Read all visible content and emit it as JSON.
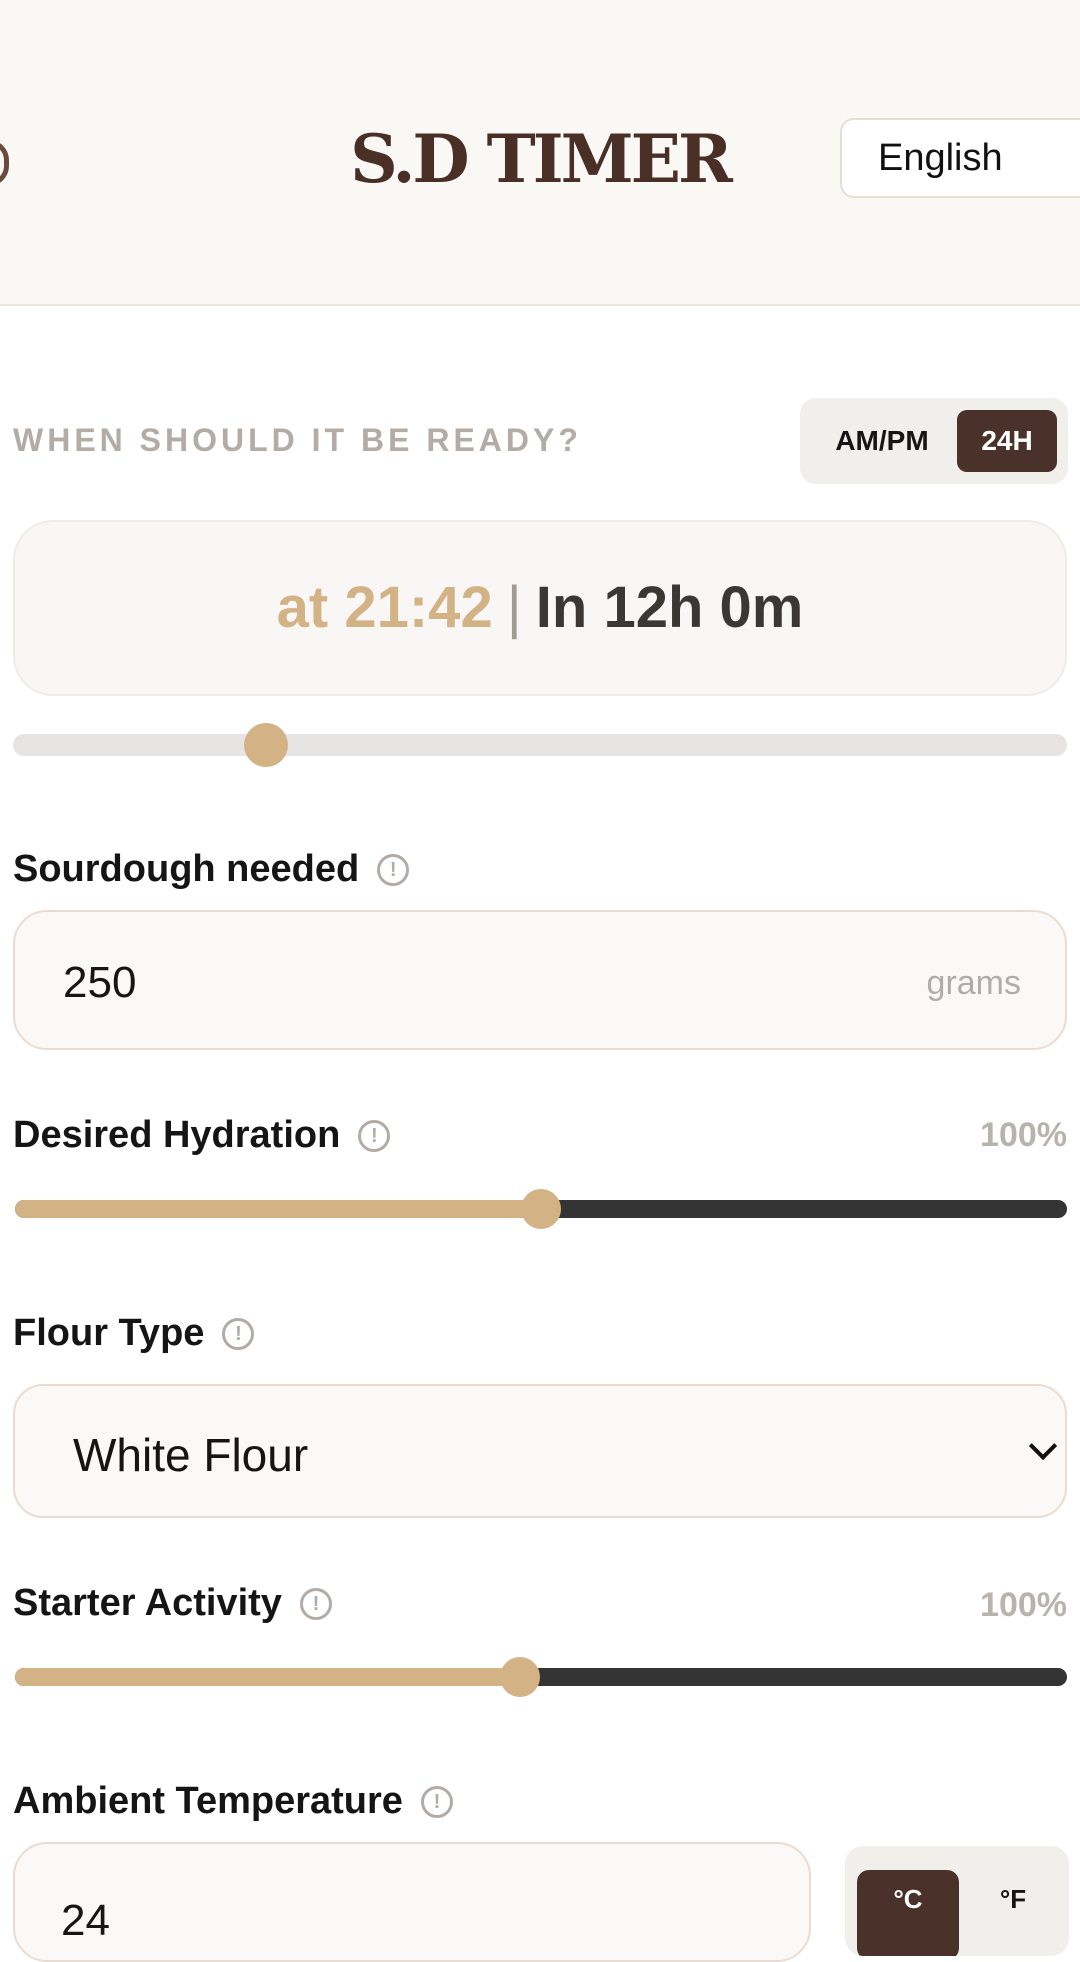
{
  "header": {
    "logo": "S.D TIMER",
    "language": "English"
  },
  "ready": {
    "label": "WHEN SHOULD IT BE READY?",
    "format_ampm": "AM/PM",
    "format_24h": "24H",
    "at_text": "at 21:42",
    "separator": "|",
    "in_text": "In 12h 0m",
    "slider_fraction": 0.24
  },
  "sourdough": {
    "label": "Sourdough needed",
    "value": "250",
    "unit": "grams"
  },
  "hydration": {
    "label": "Desired Hydration",
    "value": "100%",
    "slider_fraction": 0.5
  },
  "flour": {
    "label": "Flour Type",
    "selected": "White Flour"
  },
  "starter": {
    "label": "Starter Activity",
    "value": "100%",
    "slider_fraction": 0.48
  },
  "temperature": {
    "label": "Ambient Temperature",
    "value": "24",
    "unit_c": "°C",
    "unit_f": "°F"
  },
  "info_glyph": "!",
  "colors": {
    "accent": "#d3b385",
    "brand_dark": "#4a3129",
    "header_bg": "#faf8f4",
    "muted": "#b3aba6"
  }
}
